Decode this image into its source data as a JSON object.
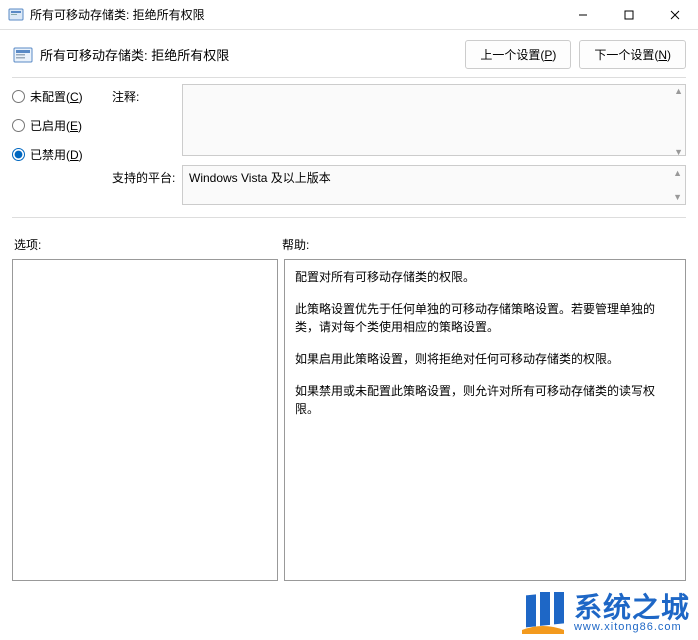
{
  "window": {
    "title": "所有可移动存储类: 拒绝所有权限"
  },
  "header": {
    "title": "所有可移动存储类: 拒绝所有权限",
    "prev_button": "上一个设置(",
    "prev_key": "P",
    "prev_button_end": ")",
    "next_button": "下一个设置(",
    "next_key": "N",
    "next_button_end": ")"
  },
  "radios": {
    "not_configured": "未配置(",
    "not_configured_key": "C",
    "not_configured_end": ")",
    "enabled": "已启用(",
    "enabled_key": "E",
    "enabled_end": ")",
    "disabled": "已禁用(",
    "disabled_key": "D",
    "disabled_end": ")",
    "selected": "disabled"
  },
  "labels": {
    "comment": "注释:",
    "platform": "支持的平台:",
    "options": "选项:",
    "help": "帮助:"
  },
  "fields": {
    "comment_value": "",
    "platform_value": "Windows Vista 及以上版本"
  },
  "help": {
    "p1": "配置对所有可移动存储类的权限。",
    "p2": "此策略设置优先于任何单独的可移动存储策略设置。若要管理单独的类，请对每个类使用相应的策略设置。",
    "p3": "如果启用此策略设置，则将拒绝对任何可移动存储类的权限。",
    "p4": "如果禁用或未配置此策略设置，则允许对所有可移动存储类的读写权限。"
  },
  "watermark": {
    "cn": "系统之城",
    "url": "www.xitong86.com"
  }
}
